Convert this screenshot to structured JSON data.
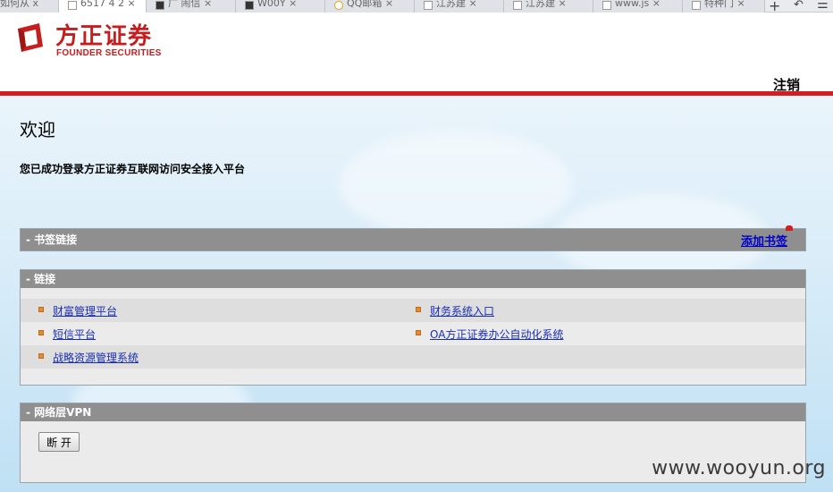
{
  "browser": {
    "tabs": [
      {
        "label": "如何从 x"
      },
      {
        "label": "6517 4 2 ×",
        "active": true
      },
      {
        "label": "广 闹信 ×"
      },
      {
        "label": "W00Y ×"
      },
      {
        "label": "QQ邮箱 ×"
      },
      {
        "label": "江苏建 ×"
      },
      {
        "label": "江苏建 ×"
      },
      {
        "label": "www.js ×"
      },
      {
        "label": "特种门 ×"
      }
    ],
    "new_tab": "+",
    "undo_icon": "↶",
    "more_icon": "☰"
  },
  "header": {
    "brand_cn": "方正证券",
    "brand_en": "FOUNDER SECURITIES",
    "logout": "注销",
    "brand_color": "#c41e1e"
  },
  "welcome": {
    "title": "欢迎",
    "subtitle": "您已成功登录方正证券互联网访问安全接入平台"
  },
  "bookmarks": {
    "title": "- 书签链接",
    "add_label": "添加书签"
  },
  "links": {
    "title": "- 链接",
    "items": [
      {
        "label": "财富管理平台"
      },
      {
        "label": "财务系统入口"
      },
      {
        "label": "短信平台"
      },
      {
        "label": "OA方正证券办公自动化系统"
      },
      {
        "label": "战略资源管理系统"
      }
    ]
  },
  "vpn": {
    "title": "- 网络层VPN",
    "disconnect": "断 开"
  },
  "watermark": "www.wooyun.org"
}
